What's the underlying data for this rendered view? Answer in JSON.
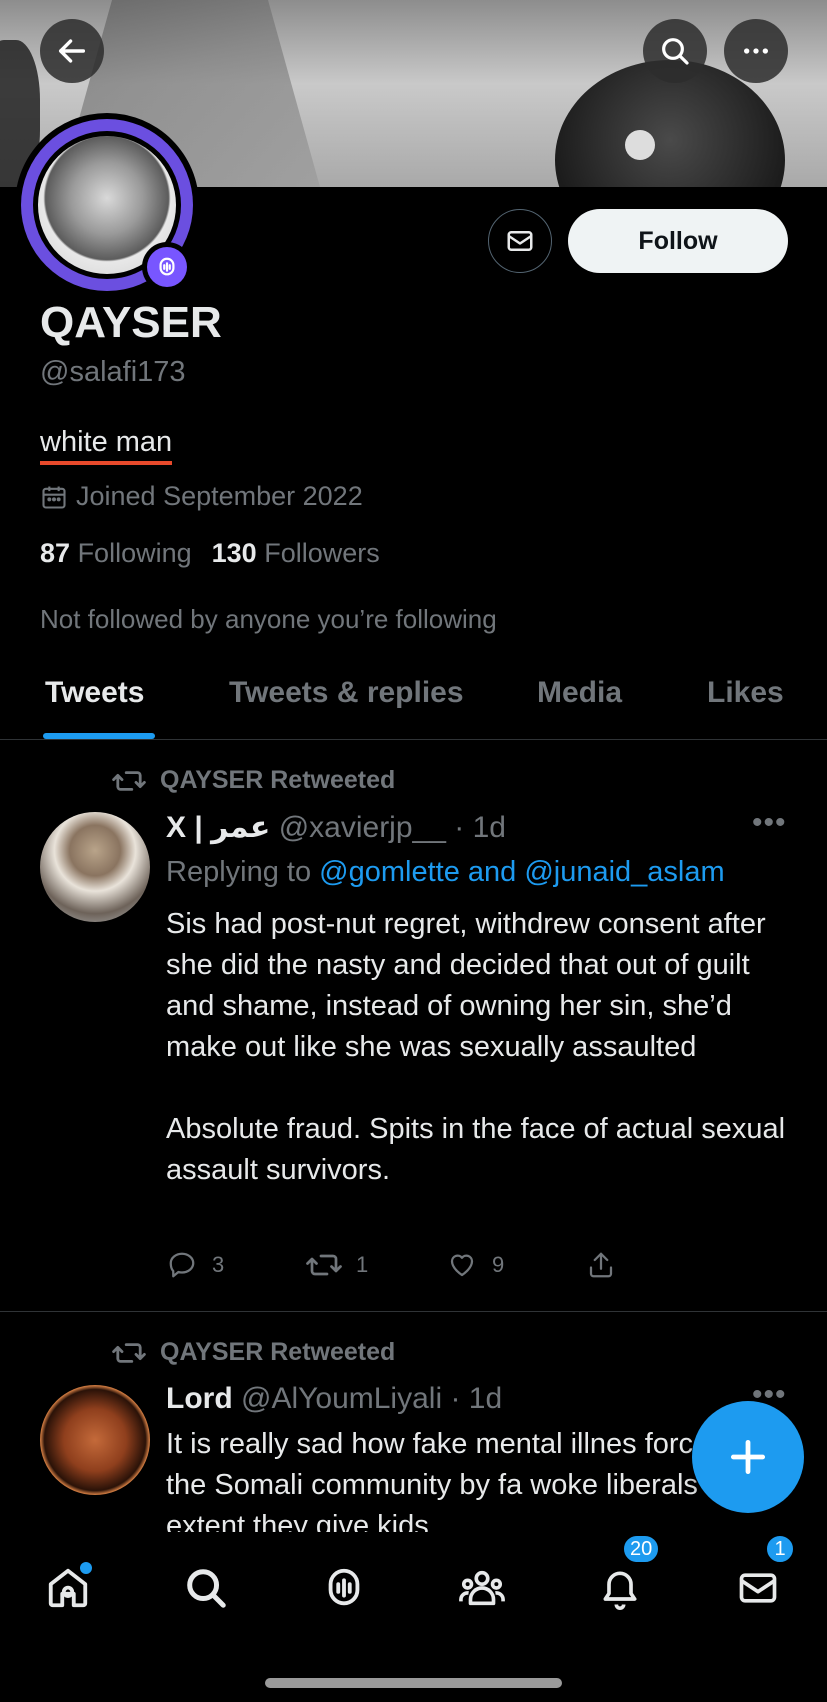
{
  "profile": {
    "display_name": "QAYSER",
    "handle": "@salafi173",
    "bio": "white man",
    "joined": "Joined September 2022",
    "following_count": "87",
    "following_label": "Following",
    "followers_count": "130",
    "followers_label": "Followers",
    "not_followed": "Not followed by anyone you’re following"
  },
  "header": {
    "follow_label": "Follow"
  },
  "tabs": [
    {
      "label": "Tweets",
      "active": true
    },
    {
      "label": "Tweets & replies",
      "active": false
    },
    {
      "label": "Media",
      "active": false
    },
    {
      "label": "Likes",
      "active": false
    }
  ],
  "tweets": [
    {
      "retweeted_by": "QAYSER Retweeted",
      "name": "X | عمر",
      "handle": "@xavierjp__",
      "time": "· 1d",
      "reply_prefix": "Replying to ",
      "reply_targets": "@gomlette and @junaid_aslam",
      "text": "Sis had post-nut regret, withdrew consent after she did the nasty and decided that out of guilt and shame, instead of owning her sin, she’d make out like she was sexually assaulted\n\nAbsolute fraud. Spits in the face of actual sexual assault survivors.",
      "replies": "3",
      "retweets": "1",
      "likes": "9"
    },
    {
      "retweeted_by": "QAYSER Retweeted",
      "name": "Lord",
      "handle": "@AlYoumLiyali",
      "time": "· 1d",
      "text": "It is really sad how fake  mental illnes forced on the Somali community by fa woke liberals to the extent they give kids"
    }
  ],
  "nav": {
    "notifications_badge": "20",
    "messages_badge": "1"
  },
  "colors": {
    "accent": "#1d9bf0",
    "space_purple": "#7856ff",
    "bio_underline": "#e8492b"
  }
}
